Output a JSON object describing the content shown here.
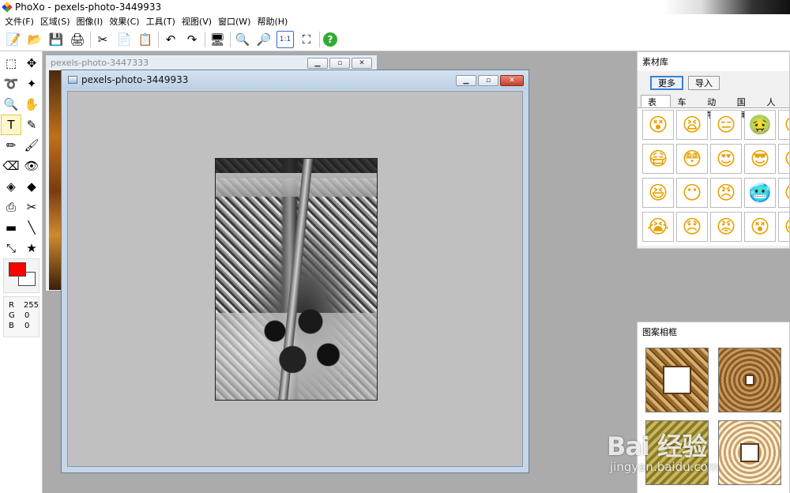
{
  "app": {
    "title": "PhoXo - pexels-photo-3449933"
  },
  "menu": [
    "文件(F)",
    "区域(S)",
    "图像(I)",
    "效果(C)",
    "工具(T)",
    "视图(V)",
    "窗口(W)",
    "帮助(H)"
  ],
  "toolbar": [
    {
      "icon": "new-icon",
      "glyph": "📝"
    },
    {
      "icon": "open-icon",
      "glyph": "📂"
    },
    {
      "icon": "save-icon",
      "glyph": "💾"
    },
    {
      "icon": "scan-icon",
      "glyph": "🖨"
    },
    {
      "icon": "cut-icon",
      "glyph": "✂"
    },
    {
      "icon": "copy-icon",
      "glyph": "📄"
    },
    {
      "icon": "paste-icon",
      "glyph": "📋"
    },
    {
      "icon": "undo-icon",
      "glyph": "↶"
    },
    {
      "icon": "redo-icon",
      "glyph": "↷"
    },
    {
      "icon": "screen-capture-icon",
      "glyph": "🖥"
    },
    {
      "icon": "zoom-in-icon",
      "glyph": "🔍"
    },
    {
      "icon": "zoom-out-icon",
      "glyph": "🔎"
    },
    {
      "icon": "actual-size-icon",
      "glyph": "1:1"
    },
    {
      "icon": "fit-window-icon",
      "glyph": "⛶"
    },
    {
      "icon": "help-icon",
      "glyph": "?"
    }
  ],
  "tools": [
    {
      "icon": "rect-select-icon",
      "glyph": "⬚"
    },
    {
      "icon": "move-select-icon",
      "glyph": "✥"
    },
    {
      "icon": "lasso-icon",
      "glyph": "➰"
    },
    {
      "icon": "magic-wand-icon",
      "glyph": "✦"
    },
    {
      "icon": "zoom-tool-icon",
      "glyph": "🔍"
    },
    {
      "icon": "hand-icon",
      "glyph": "✋"
    },
    {
      "icon": "text-tool-icon",
      "glyph": "T"
    },
    {
      "icon": "eyedropper-icon",
      "glyph": "✎"
    },
    {
      "icon": "pencil-icon",
      "glyph": "✏"
    },
    {
      "icon": "brush-icon",
      "glyph": "🖌"
    },
    {
      "icon": "eraser-icon",
      "glyph": "⌫"
    },
    {
      "icon": "red-eye-icon",
      "glyph": "👁"
    },
    {
      "icon": "fill-bucket-icon",
      "glyph": "◈"
    },
    {
      "icon": "color-replace-icon",
      "glyph": "◆"
    },
    {
      "icon": "clone-stamp-icon",
      "glyph": "⎙"
    },
    {
      "icon": "scissors-tool-icon",
      "glyph": "✂"
    },
    {
      "icon": "gradient-icon",
      "glyph": "▬"
    },
    {
      "icon": "line-tool-icon",
      "glyph": "╲"
    },
    {
      "icon": "transform-icon",
      "glyph": "⤡"
    },
    {
      "icon": "shape-star-icon",
      "glyph": "★"
    }
  ],
  "active_tool_index": 6,
  "colors": {
    "foreground": "#ff0000",
    "background": "#ffffff"
  },
  "rgb": {
    "r_label": "R",
    "r": "255",
    "g_label": "G",
    "g": "0",
    "b_label": "B",
    "b": "0"
  },
  "windows": {
    "back": {
      "title": "pexels-photo-3447333"
    },
    "front": {
      "title": "pexels-photo-3449933"
    }
  },
  "material_panel": {
    "title": "素材库",
    "more_label": "更多",
    "import_label": "导入",
    "tabs": [
      "表情",
      "车标",
      "动物",
      "国旗",
      "人物"
    ],
    "active_tab": 0,
    "emojis": [
      "😵",
      "😫",
      "😑",
      "🤢",
      "😐",
      "😷",
      "😳",
      "😍",
      "😎",
      "😊",
      "😆",
      "😶",
      "😠",
      "🥶",
      "😏",
      "😭",
      "😞",
      "😡",
      "😵",
      "😃"
    ]
  },
  "frames_panel": {
    "title": "图案相框"
  },
  "watermark": {
    "logo": "Bai 经验",
    "url": "jingyan.baidu.com"
  }
}
